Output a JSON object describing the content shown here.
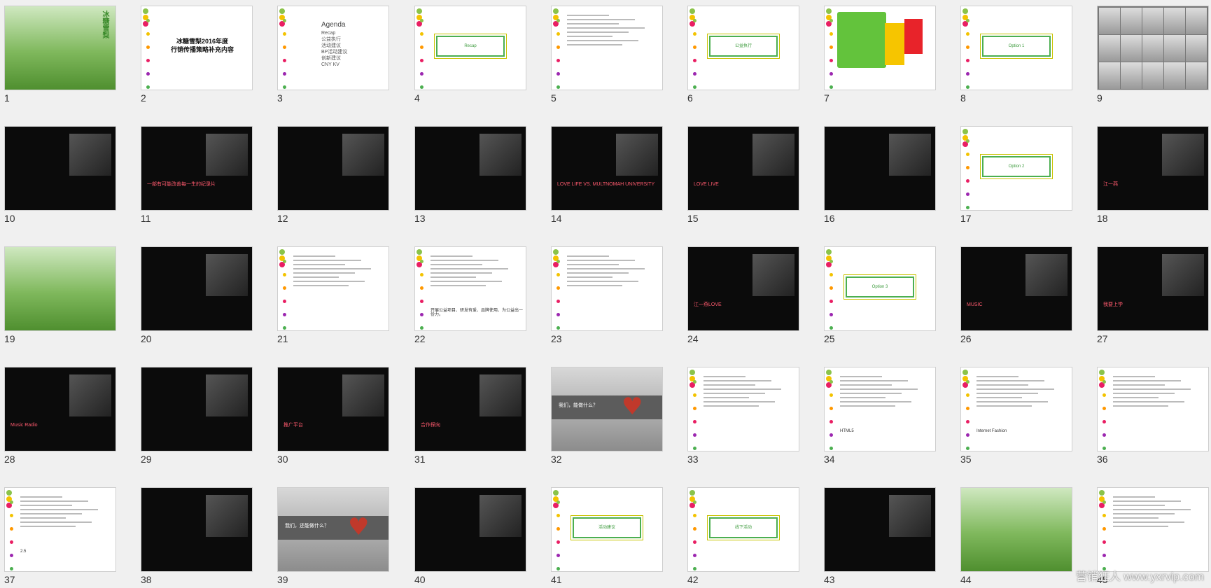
{
  "slides": [
    {
      "num": "1",
      "type": "photo",
      "label": "冰糖雪梨"
    },
    {
      "num": "2",
      "type": "title",
      "title": "冰糖雪梨2016年度\n行销传播策略补充内容"
    },
    {
      "num": "3",
      "type": "agenda",
      "heading": "Agenda",
      "items": [
        "Recap",
        "公益执行",
        "活动建议",
        "BP活动建议",
        "创新建议",
        "CNY KV"
      ]
    },
    {
      "num": "4",
      "type": "box",
      "label": "Recap"
    },
    {
      "num": "5",
      "type": "text"
    },
    {
      "num": "6",
      "type": "box",
      "label": "公益执行"
    },
    {
      "num": "7",
      "type": "diagram"
    },
    {
      "num": "8",
      "type": "box",
      "label": "Option 1"
    },
    {
      "num": "9",
      "type": "faces"
    },
    {
      "num": "10",
      "type": "dark"
    },
    {
      "num": "11",
      "type": "dark",
      "caption": "一部有可能改善每一生的纪录片"
    },
    {
      "num": "12",
      "type": "dark"
    },
    {
      "num": "13",
      "type": "dark"
    },
    {
      "num": "14",
      "type": "dark",
      "caption": "LOVE LIFE VS. MULTNOMAH UNIVERSITY"
    },
    {
      "num": "15",
      "type": "dark",
      "caption": "LOVE LIVE"
    },
    {
      "num": "16",
      "type": "dark"
    },
    {
      "num": "17",
      "type": "box",
      "label": "Option 2"
    },
    {
      "num": "18",
      "type": "dark",
      "caption": "江一燕"
    },
    {
      "num": "19",
      "type": "photo",
      "label": ""
    },
    {
      "num": "20",
      "type": "dark"
    },
    {
      "num": "21",
      "type": "light"
    },
    {
      "num": "22",
      "type": "light",
      "caption": "开展公益项目、研发有爱、品牌使用、为公益出一份力。"
    },
    {
      "num": "23",
      "type": "light"
    },
    {
      "num": "24",
      "type": "dark",
      "caption": "江一燕LOVE"
    },
    {
      "num": "25",
      "type": "box",
      "label": "Option 3"
    },
    {
      "num": "26",
      "type": "dark",
      "caption": "MUSIC"
    },
    {
      "num": "27",
      "type": "dark",
      "caption": "我要上学"
    },
    {
      "num": "28",
      "type": "dark",
      "caption": "Music Radio"
    },
    {
      "num": "29",
      "type": "dark"
    },
    {
      "num": "30",
      "type": "dark",
      "caption": "推广平台"
    },
    {
      "num": "31",
      "type": "dark",
      "caption": "合作探向"
    },
    {
      "num": "32",
      "type": "gray",
      "caption": "我们，能做什么？"
    },
    {
      "num": "33",
      "type": "light"
    },
    {
      "num": "34",
      "type": "light",
      "caption": "HTML5"
    },
    {
      "num": "35",
      "type": "light",
      "caption": "Internet Fashion"
    },
    {
      "num": "36",
      "type": "light"
    },
    {
      "num": "37",
      "type": "light",
      "caption": "2.5"
    },
    {
      "num": "38",
      "type": "dark"
    },
    {
      "num": "39",
      "type": "gray",
      "caption": "我们，还能做什么？"
    },
    {
      "num": "40",
      "type": "dark"
    },
    {
      "num": "41",
      "type": "box",
      "label": "活动建议"
    },
    {
      "num": "42",
      "type": "box",
      "label": "线下活动"
    },
    {
      "num": "43",
      "type": "dark"
    },
    {
      "num": "44",
      "type": "photo",
      "label": ""
    },
    {
      "num": "45",
      "type": "light"
    }
  ],
  "watermark": "营销狂人 www.yxrvip.com",
  "colors": {
    "dots": [
      "#8bc34a",
      "#f3c300",
      "#ff9800",
      "#e91e63",
      "#9c27b0",
      "#4caf50"
    ],
    "green": "#4caf50",
    "pink": "#e5327d",
    "dark": "#0b0b0b"
  }
}
